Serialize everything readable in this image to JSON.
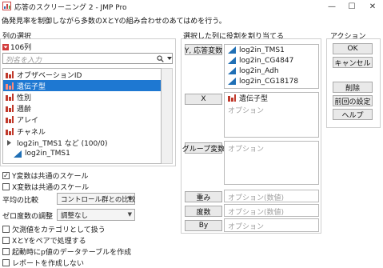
{
  "window": {
    "title": "応答のスクリーニング 2 - JMP Pro",
    "minimize_glyph": "—",
    "maximize_glyph": "☐",
    "close_glyph": "✕",
    "app_icon": "jmp-app-icon"
  },
  "description": "偽発見率を制御しながら多数のXとYの組み合わせのあてはめを行う。",
  "column_selection": {
    "header": "列の選択",
    "count": "106列",
    "search_placeholder": "列名を入力",
    "search_icon": "search-icon",
    "menu_icon": "chevron-down-icon",
    "items": [
      {
        "label": "オブザベーションID",
        "icon": "nominal-icon",
        "selected": false,
        "indent": false
      },
      {
        "label": "遺伝子型",
        "icon": "nominal-icon",
        "selected": true,
        "indent": false
      },
      {
        "label": "性別",
        "icon": "nominal-icon",
        "selected": false,
        "indent": false
      },
      {
        "label": "週齢",
        "icon": "nominal-icon",
        "selected": false,
        "indent": false
      },
      {
        "label": "アレイ",
        "icon": "nominal-icon",
        "selected": false,
        "indent": false
      },
      {
        "label": "チャネル",
        "icon": "nominal-icon",
        "selected": false,
        "indent": false
      },
      {
        "label": "log2in_TMS1 など (100/0)",
        "icon": "group-expand-icon",
        "selected": false,
        "indent": false
      },
      {
        "label": "log2in_TMS1",
        "icon": "continuous-icon",
        "selected": false,
        "indent": true
      }
    ]
  },
  "options": {
    "y_common_scale": "Y変数は共通のスケール",
    "y_common_scale_checked": true,
    "x_common_scale": "X変数は共通のスケール",
    "x_common_scale_checked": false,
    "mean_comparison_label": "平均の比較",
    "mean_comparison_value": "コントロール群との比較",
    "zero_adjust_label": "ゼロ度数の調整",
    "zero_adjust_value": "調整なし",
    "missing_as_category": "欠測値をカテゴリとして扱う",
    "missing_as_category_checked": false,
    "pair_xy": "XとYをペアで処理する",
    "pair_xy_checked": false,
    "pvalue_table": "起動時にp値のデータテーブルを作成",
    "pvalue_table_checked": false,
    "no_report": "レポートを作成しない",
    "no_report_checked": false
  },
  "roles": {
    "header": "選択した列に役割を割り当てる",
    "y_button": "Y, 応答変数",
    "y_items": [
      "log2in_TMS1",
      "log2in_CG4847",
      "log2in_Adh",
      "log2in_CG18178"
    ],
    "x_button": "X",
    "x_items": [
      "遺伝子型"
    ],
    "x_placeholder": "オプション",
    "group_button": "グループ変数",
    "group_placeholder": "オプション",
    "weight_button": "重み",
    "weight_placeholder": "オプション(数値)",
    "freq_button": "度数",
    "freq_placeholder": "オプション(数値)",
    "by_button": "By",
    "by_placeholder": "オプション"
  },
  "actions": {
    "header": "アクション",
    "ok": "OK",
    "cancel": "キャンセル",
    "remove": "削除",
    "recall": "前回の設定",
    "help": "ヘルプ"
  },
  "colors": {
    "selection": "#1e78d2",
    "nominal_icon": "#c0392b",
    "continuous_icon": "#1f6fb5"
  }
}
